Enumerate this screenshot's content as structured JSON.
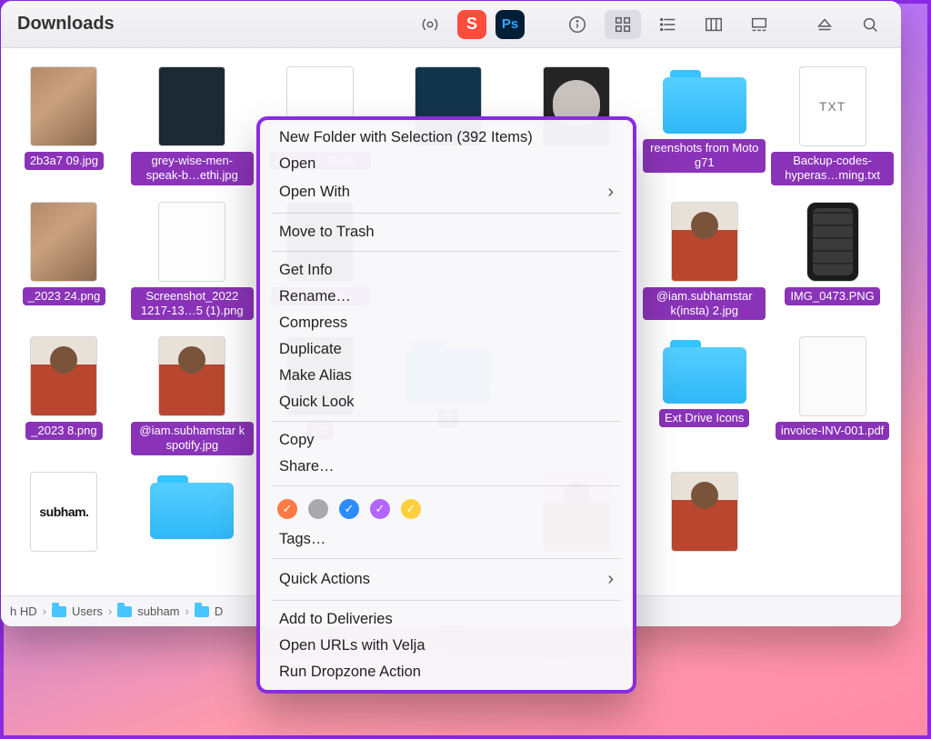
{
  "window": {
    "title": "Downloads"
  },
  "toolbar_apps": {
    "s": "S",
    "ps": "Ps"
  },
  "path": [
    "h HD",
    "Users",
    "subham",
    "D"
  ],
  "files": [
    {
      "label": "2b3a7 09.jpg",
      "kind": "photo"
    },
    {
      "label": "grey-wise-men-speak-b…ethi.jpg",
      "kind": "dark"
    },
    {
      "label": "image_d -9846…",
      "kind": "paper"
    },
    {
      "label": "",
      "kind": "darkblue"
    },
    {
      "label": "",
      "kind": "cat"
    },
    {
      "label": "reenshots from Moto g71",
      "kind": "folder"
    },
    {
      "label": "Backup-codes-hyperas…ming.txt",
      "kind": "txt",
      "txt": "TXT"
    },
    {
      "label": "_2023 24.png",
      "kind": "photo"
    },
    {
      "label": "Screenshot_2022 1217-13…5 (1).png",
      "kind": "list"
    },
    {
      "label": "Screens 1128-…",
      "kind": "black"
    },
    {
      "label": "",
      "kind": "blank"
    },
    {
      "label": "",
      "kind": "blank"
    },
    {
      "label": "@iam.subhamstar k(insta) 2.jpg",
      "kind": "selfie"
    },
    {
      "label": "IMG_0473.PNG",
      "kind": "phone"
    },
    {
      "label": "_2023 8.png",
      "kind": "selfie"
    },
    {
      "label": "@iam.subhamstar k spotify.jpg",
      "kind": "selfie"
    },
    {
      "label": "SD",
      "kind": "black"
    },
    {
      "label": "D",
      "kind": "folder"
    },
    {
      "label": "",
      "kind": "blank"
    },
    {
      "label": "Ext Drive Icons",
      "kind": "folder"
    },
    {
      "label": "invoice-INV-001.pdf",
      "kind": "doc"
    },
    {
      "label": "",
      "kind": "subham",
      "txt": "subham."
    },
    {
      "label": "",
      "kind": "folder"
    },
    {
      "label": "",
      "kind": "blank"
    },
    {
      "label": "",
      "kind": "blank"
    },
    {
      "label": "",
      "kind": "selfie"
    },
    {
      "label": "",
      "kind": "selfie"
    },
    {
      "label": "",
      "kind": "blank"
    }
  ],
  "menu": {
    "new_folder": "New Folder with Selection (392 Items)",
    "open": "Open",
    "open_with": "Open With",
    "trash": "Move to Trash",
    "get_info": "Get Info",
    "rename": "Rename…",
    "compress": "Compress",
    "duplicate": "Duplicate",
    "alias": "Make Alias",
    "quick_look": "Quick Look",
    "copy": "Copy",
    "share": "Share…",
    "tags": "Tags…",
    "quick_actions": "Quick Actions",
    "deliveries": "Add to Deliveries",
    "velja": "Open URLs with Velja",
    "dropzone": "Run Dropzone Action"
  }
}
